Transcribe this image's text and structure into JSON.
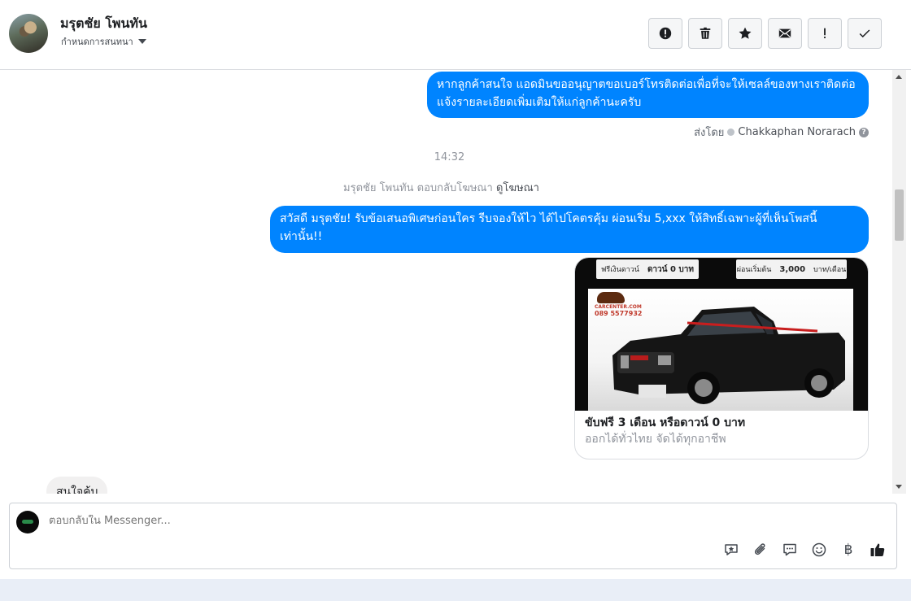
{
  "header": {
    "contact_name": "มรุตชัย โพนทัน",
    "assign_label": "กำหนดการสนทนา",
    "actions": [
      {
        "name": "report-spam-button",
        "icon": "alert-circle-icon"
      },
      {
        "name": "delete-button",
        "icon": "trash-icon"
      },
      {
        "name": "star-button",
        "icon": "star-icon"
      },
      {
        "name": "mark-unread-button",
        "icon": "envelope-icon"
      },
      {
        "name": "follow-up-button",
        "icon": "exclamation-icon"
      },
      {
        "name": "mark-done-button",
        "icon": "check-icon"
      }
    ]
  },
  "conversation": {
    "message_1": "หากลูกค้าสนใจ แอดมินขออนุญาตขอเบอร์โทรติดต่อเพื่อที่จะให้เซลล์ของทางเราติดต่อแจ้งรายละเอียดเพิ่มเติมให้แก่ลูกค้านะครับ",
    "sent_by_label": "ส่งโดย",
    "sent_by_agent": "Chakkaphan Norarach",
    "timestamp": "14:32",
    "reply_note": "มรุตชัย โพนทัน ตอบกลับโฆษณา",
    "view_ad_link": "ดูโฆษณา",
    "message_2": "สวัสดี มรุตชัย! รับข้อเสนอพิเศษก่อนใคร รีบจองให้ไว ได้ไปโคตรคุ้ม ผ่อนเริ่ม 5,xxx  ให้สิทธิ์เฉพาะผู้ที่เห็นโพสนี้เท่านั้น!!",
    "ad": {
      "promo_left_small": "ฟรีเงินดาวน์",
      "promo_left": "ดาวน์ 0 บาท",
      "promo_right_small": "ผ่อนเริ่มต้น",
      "promo_right": "3,000",
      "promo_right_unit": "บาท/เดือน",
      "dealer_brand": "CARCENTER.COM",
      "dealer_phone": "089 5577932",
      "title": "ขับฟรี 3 เดือน หรือดาวน์ 0 บาท",
      "subtitle": "ออกได้ทั่วไทย จัดได้ทุกอาชีพ"
    },
    "incoming_message": "สนใจค้บ"
  },
  "composer": {
    "placeholder": "ตอบกลับใน Messenger...",
    "tools": [
      "saved-reply-icon",
      "attachment-icon",
      "chat-bubble-icon",
      "emoji-icon",
      "baht-icon",
      "thumbs-up-icon"
    ],
    "baht_symbol": "฿"
  },
  "colors": {
    "outgoing_bubble": "#0084ff",
    "incoming_bubble": "#f1f0f0",
    "muted_text": "#90949c"
  }
}
